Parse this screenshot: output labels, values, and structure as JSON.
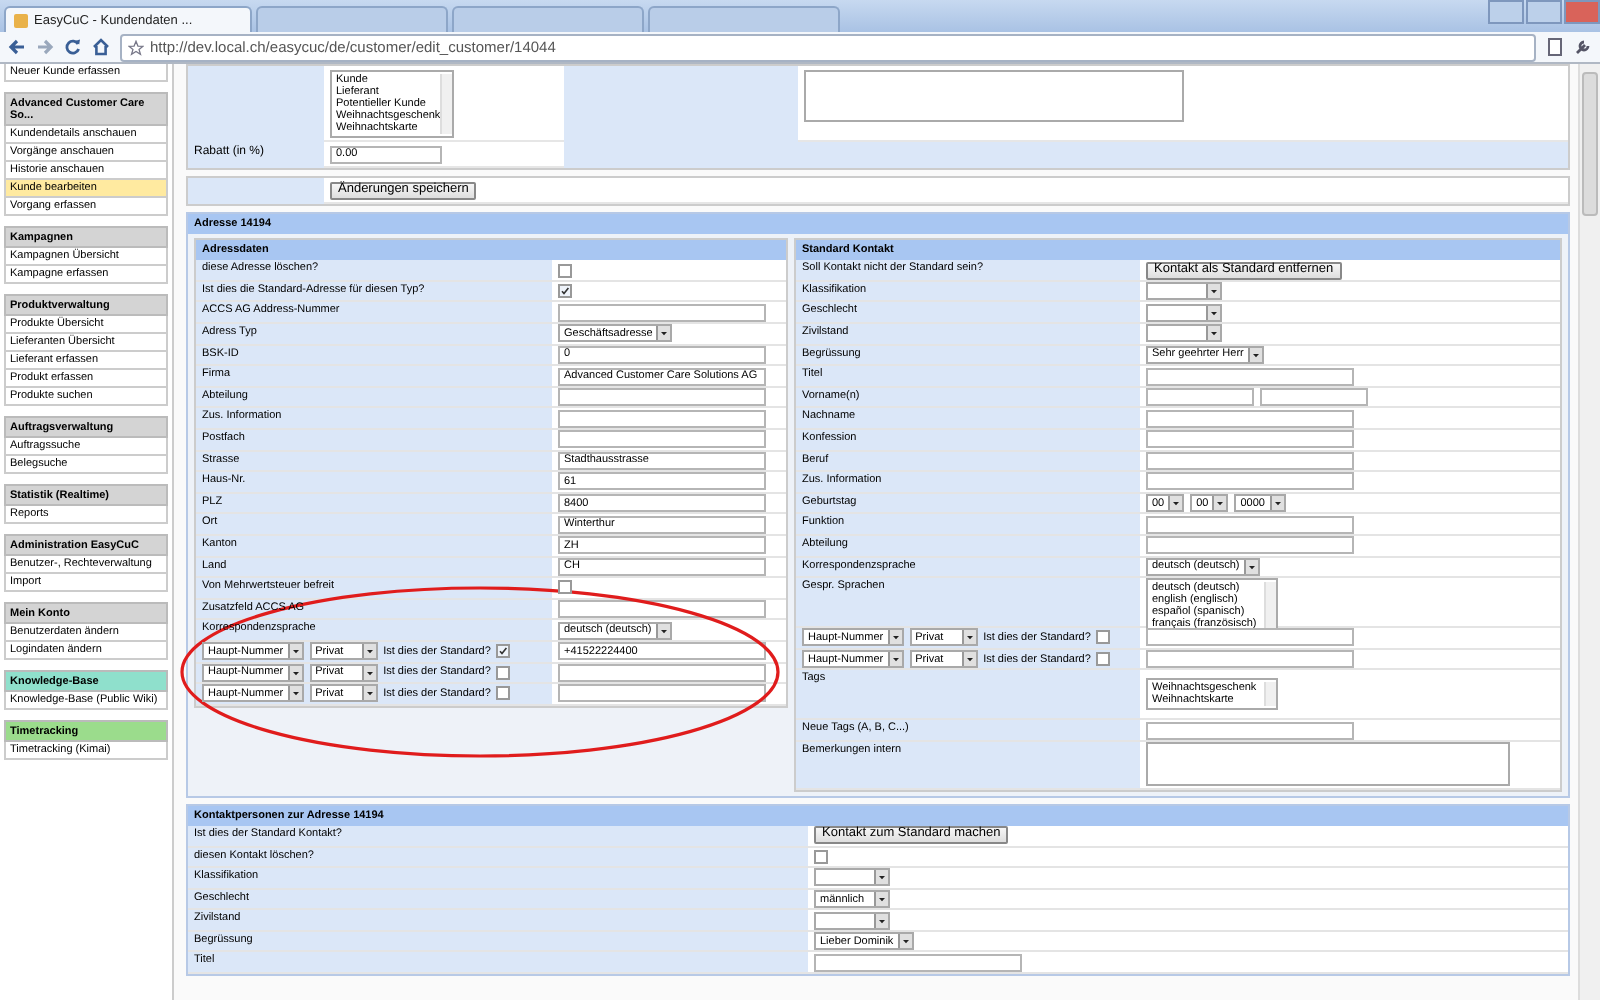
{
  "browser": {
    "tabs": [
      {
        "title": "EasyCuC - Kundendaten ...",
        "selected": true
      },
      {
        "selected": false
      },
      {
        "selected": false
      },
      {
        "selected": false
      }
    ],
    "url": "http://dev.local.ch/easycuc/de/customer/edit_customer/14044"
  },
  "sidebar": {
    "top_item": "Neuer Kunde erfassen",
    "groups": [
      {
        "title": "Advanced Customer Care So...",
        "color": "#d4d4d4",
        "items": [
          {
            "label": "Kundendetails anschauen",
            "selected": false
          },
          {
            "label": "Vorgänge anschauen",
            "selected": false
          },
          {
            "label": "Historie anschauen",
            "selected": false
          },
          {
            "label": "Kunde bearbeiten",
            "selected": true
          },
          {
            "label": "Vorgang erfassen",
            "selected": false
          }
        ]
      },
      {
        "title": "Kampagnen",
        "color": "#d4d4d4",
        "items": [
          {
            "label": "Kampagnen Übersicht",
            "selected": false
          },
          {
            "label": "Kampagne erfassen",
            "selected": false
          }
        ]
      },
      {
        "title": "Produktverwaltung",
        "color": "#d4d4d4",
        "items": [
          {
            "label": "Produkte Übersicht",
            "selected": false
          },
          {
            "label": "Lieferanten Übersicht",
            "selected": false
          },
          {
            "label": "Lieferant erfassen",
            "selected": false
          },
          {
            "label": "Produkt erfassen",
            "selected": false
          },
          {
            "label": "Produkte suchen",
            "selected": false
          }
        ]
      },
      {
        "title": "Auftragsverwaltung",
        "color": "#d4d4d4",
        "items": [
          {
            "label": "Auftragssuche",
            "selected": false
          },
          {
            "label": "Belegsuche",
            "selected": false
          }
        ]
      },
      {
        "title": "Statistik (Realtime)",
        "color": "#d4d4d4",
        "items": [
          {
            "label": "Reports",
            "selected": false
          }
        ]
      },
      {
        "title": "Administration EasyCuC",
        "color": "#d4d4d4",
        "items": [
          {
            "label": "Benutzer-, Rechteverwaltung",
            "selected": false
          },
          {
            "label": "Import",
            "selected": false
          }
        ]
      },
      {
        "title": "Mein Konto",
        "color": "#d4d4d4",
        "items": [
          {
            "label": "Benutzerdaten ändern",
            "selected": false
          },
          {
            "label": "Logindaten ändern",
            "selected": false
          }
        ]
      },
      {
        "title": "Knowledge-Base",
        "color": "#8fe0cc",
        "items": [
          {
            "label": "Knowledge-Base (Public Wiki)",
            "selected": false
          }
        ]
      },
      {
        "title": "Timetracking",
        "color": "#9bdc8c",
        "items": [
          {
            "label": "Timetracking (Kimai)",
            "selected": false
          }
        ]
      }
    ]
  },
  "top_form": {
    "categories": [
      "Kunde",
      "Lieferant",
      "Potentieller Kunde",
      "Weihnachtsgeschenk",
      "Weihnachtskarte"
    ],
    "discount_label": "Rabatt (in %)",
    "discount_value": "0.00",
    "save_button": "Änderungen speichern"
  },
  "address": {
    "title": "Adresse 14194",
    "left": {
      "title": "Adressdaten",
      "rows": [
        {
          "kind": "checkbox",
          "label": "diese Adresse löschen?",
          "checked": false
        },
        {
          "kind": "checkbox",
          "label": "Ist dies die Standard-Adresse für diesen Typ?",
          "checked": true
        },
        {
          "kind": "text",
          "label": "ACCS AG Address-Nummer"
        },
        {
          "kind": "select",
          "label": "Adress Typ",
          "value": "Geschäftsadresse"
        },
        {
          "kind": "text",
          "label": "BSK-ID",
          "value": "0"
        },
        {
          "kind": "text",
          "label": "Firma",
          "value": "Advanced Customer Care Solutions AG"
        },
        {
          "kind": "text",
          "label": "Abteilung"
        },
        {
          "kind": "text",
          "label": "Zus. Information"
        },
        {
          "kind": "text",
          "label": "Postfach"
        },
        {
          "kind": "text",
          "label": "Strasse",
          "value": "Stadthausstrasse"
        },
        {
          "kind": "text",
          "label": "Haus-Nr.",
          "value": "61"
        },
        {
          "kind": "text",
          "label": "PLZ",
          "value": "8400"
        },
        {
          "kind": "text",
          "label": "Ort",
          "value": "Winterthur"
        },
        {
          "kind": "text",
          "label": "Kanton",
          "value": "ZH"
        },
        {
          "kind": "text",
          "label": "Land",
          "value": "CH"
        },
        {
          "kind": "checkbox",
          "label": "Von Mehrwertsteuer befreit",
          "checked": false
        },
        {
          "kind": "text",
          "label": "Zusatzfeld ACCS AG"
        },
        {
          "kind": "select",
          "label": "Korrespondenzsprache",
          "value": "deutsch (deutsch)"
        },
        {
          "kind": "phone",
          "type": "Haupt-Nummer",
          "category": "Privat",
          "question": "Ist dies der Standard?",
          "checked": true,
          "value": "+41522224400"
        },
        {
          "kind": "phone",
          "type": "Haupt-Nummer",
          "category": "Privat",
          "question": "Ist dies der Standard?",
          "checked": false
        },
        {
          "kind": "phone",
          "type": "Haupt-Nummer",
          "category": "Privat",
          "question": "Ist dies der Standard?",
          "checked": false
        }
      ]
    },
    "right": {
      "title": "Standard Kontakt",
      "rows": [
        {
          "kind": "button",
          "label": "Soll Kontakt nicht der Standard sein?",
          "button": "Kontakt als Standard entfernen"
        },
        {
          "kind": "select",
          "label": "Klassifikation"
        },
        {
          "kind": "select",
          "label": "Geschlecht"
        },
        {
          "kind": "select",
          "label": "Zivilstand"
        },
        {
          "kind": "select",
          "label": "Begrüssung",
          "value": "Sehr geehrter Herr"
        },
        {
          "kind": "text",
          "label": "Titel"
        },
        {
          "kind": "name",
          "label": "Vorname(n)"
        },
        {
          "kind": "text",
          "label": "Nachname"
        },
        {
          "kind": "text",
          "label": "Konfession"
        },
        {
          "kind": "text",
          "label": "Beruf"
        },
        {
          "kind": "text",
          "label": "Zus. Information"
        },
        {
          "kind": "date",
          "label": "Geburtstag",
          "parts": [
            "00",
            "00",
            "0000"
          ]
        },
        {
          "kind": "text",
          "label": "Funktion"
        },
        {
          "kind": "text",
          "label": "Abteilung"
        },
        {
          "kind": "select",
          "label": "Korrespondenzsprache",
          "value": "deutsch (deutsch)"
        },
        {
          "kind": "listbox",
          "label": "Gespr. Sprachen",
          "options": [
            "deutsch (deutsch)",
            "english (englisch)",
            "español (spanisch)",
            "français (französisch)"
          ]
        },
        {
          "kind": "phone",
          "type": "Haupt-Nummer",
          "category": "Privat",
          "question": "Ist dies der Standard?",
          "checked": false
        },
        {
          "kind": "phone",
          "type": "Haupt-Nummer",
          "category": "Privat",
          "question": "Ist dies der Standard?",
          "checked": false
        },
        {
          "kind": "listbox",
          "label": "Tags",
          "options": [
            "Weihnachtsgeschenk",
            "Weihnachtskarte"
          ]
        },
        {
          "kind": "text",
          "label": "Neue Tags (A, B, C...)"
        },
        {
          "kind": "textarea",
          "label": "Bemerkungen intern"
        }
      ]
    }
  },
  "contacts": {
    "title": "Kontaktpersonen zur Adresse 14194",
    "rows": [
      {
        "kind": "button",
        "label": "Ist dies der Standard Kontakt?",
        "button": "Kontakt zum Standard machen"
      },
      {
        "kind": "checkbox",
        "label": "diesen Kontakt löschen?",
        "checked": false
      },
      {
        "kind": "select",
        "label": "Klassifikation"
      },
      {
        "kind": "select",
        "label": "Geschlecht",
        "value": "männlich"
      },
      {
        "kind": "select",
        "label": "Zivilstand"
      },
      {
        "kind": "select",
        "label": "Begrüssung",
        "value": "Lieber Dominik"
      },
      {
        "kind": "text",
        "label": "Titel"
      }
    ]
  }
}
